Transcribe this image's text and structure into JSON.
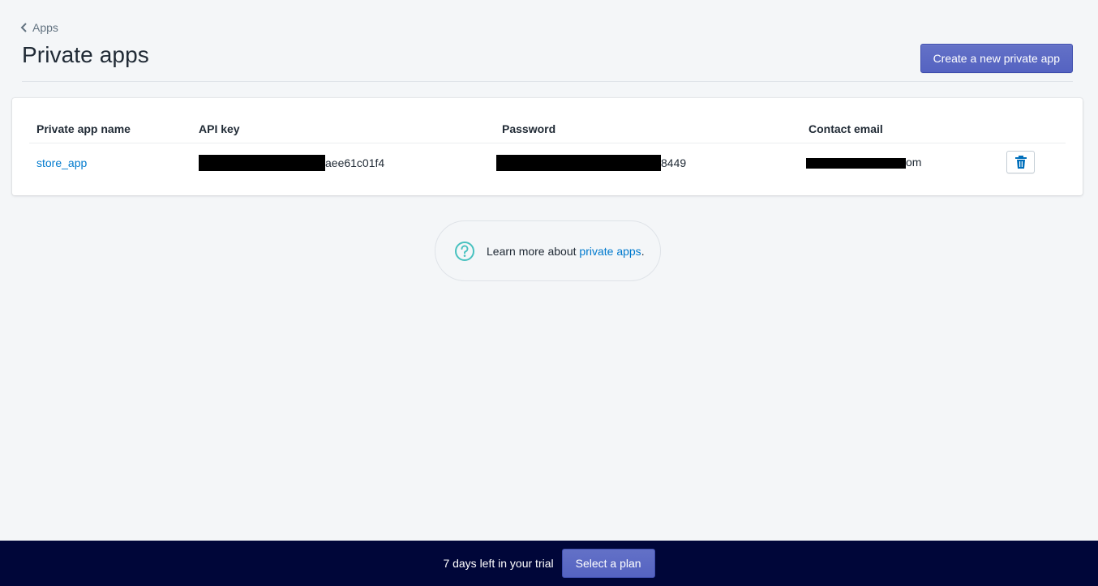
{
  "breadcrumb": {
    "label": "Apps"
  },
  "page": {
    "title": "Private apps",
    "create_button_label": "Create a new private app"
  },
  "table": {
    "headers": {
      "name": "Private app name",
      "api_key": "API key",
      "password": "Password",
      "email": "Contact email"
    },
    "rows": [
      {
        "name": "store_app",
        "api_key_suffix": "aee61c01f4",
        "password_suffix": "8449",
        "email_suffix": "om"
      }
    ]
  },
  "help": {
    "prefix": "Learn more about ",
    "link_label": "private apps",
    "suffix": "."
  },
  "trial": {
    "message": "7 days left in your trial",
    "button_label": "Select a plan"
  },
  "icons": {
    "breadcrumb": "chevron-left-icon",
    "delete": "trash-icon",
    "help": "question-circle-icon"
  },
  "colors": {
    "accent": "#5c6ac4",
    "link": "#007ace",
    "footer": "#000639",
    "help_icon": "#47c1bf",
    "trash": "#006fbb"
  }
}
